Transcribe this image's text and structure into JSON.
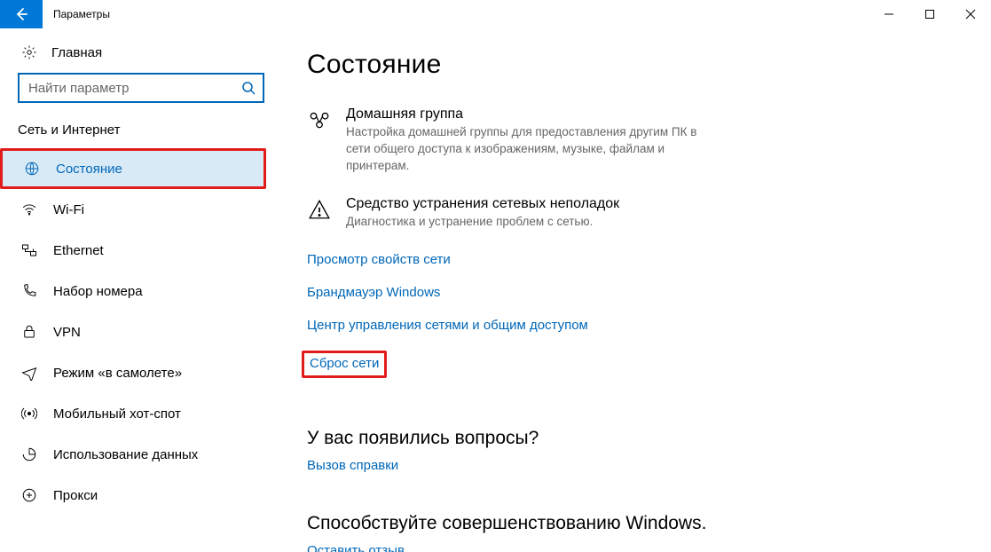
{
  "window": {
    "title": "Параметры"
  },
  "sidebar": {
    "home_label": "Главная",
    "search_placeholder": "Найти параметр",
    "section_header": "Сеть и Интернет",
    "items": [
      {
        "label": "Состояние"
      },
      {
        "label": "Wi-Fi"
      },
      {
        "label": "Ethernet"
      },
      {
        "label": "Набор номера"
      },
      {
        "label": "VPN"
      },
      {
        "label": "Режим «в самолете»"
      },
      {
        "label": "Мобильный хот-спот"
      },
      {
        "label": "Использование данных"
      },
      {
        "label": "Прокси"
      }
    ]
  },
  "main": {
    "heading": "Состояние",
    "features": [
      {
        "title": "Домашняя группа",
        "desc": "Настройка домашней группы для предоставления другим ПК в сети общего доступа к изображениям, музыке, файлам и принтерам."
      },
      {
        "title": "Средство устранения сетевых неполадок",
        "desc": "Диагностика и устранение проблем с сетью."
      }
    ],
    "links": [
      "Просмотр свойств сети",
      "Брандмауэр Windows",
      "Центр управления сетями и общим доступом",
      "Сброс сети"
    ],
    "questions_title": "У вас появились вопросы?",
    "questions_link": "Вызов справки",
    "improve_title": "Способствуйте совершенствованию Windows.",
    "improve_link": "Оставить отзыв"
  }
}
